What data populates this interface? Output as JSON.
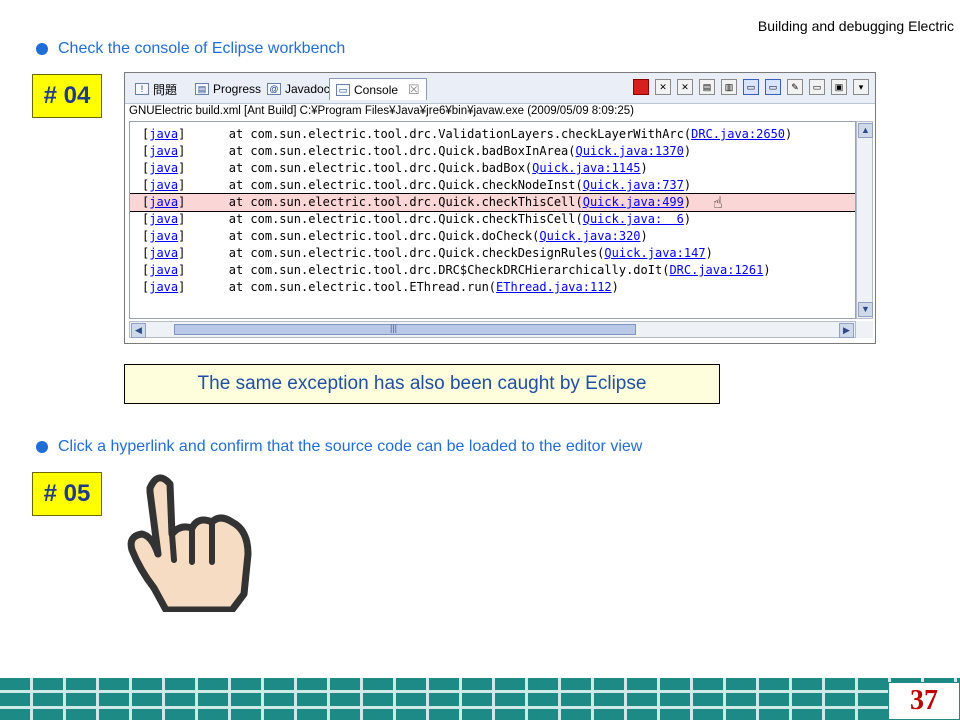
{
  "header": {
    "title": "Building and debugging Electric"
  },
  "bullets": [
    {
      "text": "Check the console of Eclipse workbench"
    },
    {
      "text": "Click a hyperlink and confirm that the source code can be loaded to the editor view"
    }
  ],
  "steps": [
    {
      "label": "# 04"
    },
    {
      "label": "# 05"
    }
  ],
  "eclipse": {
    "tabs": [
      {
        "label": "問題",
        "icon": "problems-icon"
      },
      {
        "label": "Progress",
        "icon": "progress-icon"
      },
      {
        "label": "Javadoc",
        "icon": "at-icon"
      },
      {
        "label": "Console",
        "icon": "console-icon",
        "close": "☒"
      }
    ],
    "launch_line": "GNUElectric build.xml [Ant Build] C:¥Program Files¥Java¥jre6¥bin¥javaw.exe (2009/05/09 8:09:25)",
    "console_lines": [
      {
        "tag": "java",
        "text": "      at com.sun.electric.tool.drc.ValidationLayers.checkLayerWithArc(",
        "link": "DRC.java:2650",
        "end": ")"
      },
      {
        "tag": "java",
        "text": "      at com.sun.electric.tool.drc.Quick.badBoxInArea(",
        "link": "Quick.java:1370",
        "end": ")"
      },
      {
        "tag": "java",
        "text": "      at com.sun.electric.tool.drc.Quick.badBox(",
        "link": "Quick.java:1145",
        "end": ")"
      },
      {
        "tag": "java",
        "text": "      at com.sun.electric.tool.drc.Quick.checkNodeInst(",
        "link": "Quick.java:737",
        "end": ")"
      },
      {
        "tag": "java",
        "text": "      at com.sun.electric.tool.drc.Quick.checkThisCell(",
        "link": "Quick.java:499",
        "end": ")",
        "highlight": true
      },
      {
        "tag": "java",
        "text": "      at com.sun.electric.tool.drc.Quick.checkThisCell(",
        "link": "Quick.java:  6",
        "end": ")"
      },
      {
        "tag": "java",
        "text": "      at com.sun.electric.tool.drc.Quick.doCheck(",
        "link": "Quick.java:320",
        "end": ")"
      },
      {
        "tag": "java",
        "text": "      at com.sun.electric.tool.drc.Quick.checkDesignRules(",
        "link": "Quick.java:147",
        "end": ")"
      },
      {
        "tag": "java",
        "text": "      at com.sun.electric.tool.drc.DRC$CheckDRCHierarchically.doIt(",
        "link": "DRC.java:1261",
        "end": ")"
      },
      {
        "tag": "java",
        "text": "      at com.sun.electric.tool.EThread.run(",
        "link": "EThread.java:112",
        "end": ")"
      }
    ],
    "bracket_open": "[",
    "bracket_close": "]",
    "hscroll_grip": "|||",
    "arrows": {
      "up": "▲",
      "down": "▼",
      "left": "◀",
      "right": "▶"
    }
  },
  "note": {
    "text": "The same exception has also been caught by Eclipse"
  },
  "page": {
    "number": "37"
  },
  "colors": {
    "accent": "#1f6ed8",
    "badge": "#ffff00",
    "footer": "#1e8a86",
    "page_number": "#c00000"
  }
}
